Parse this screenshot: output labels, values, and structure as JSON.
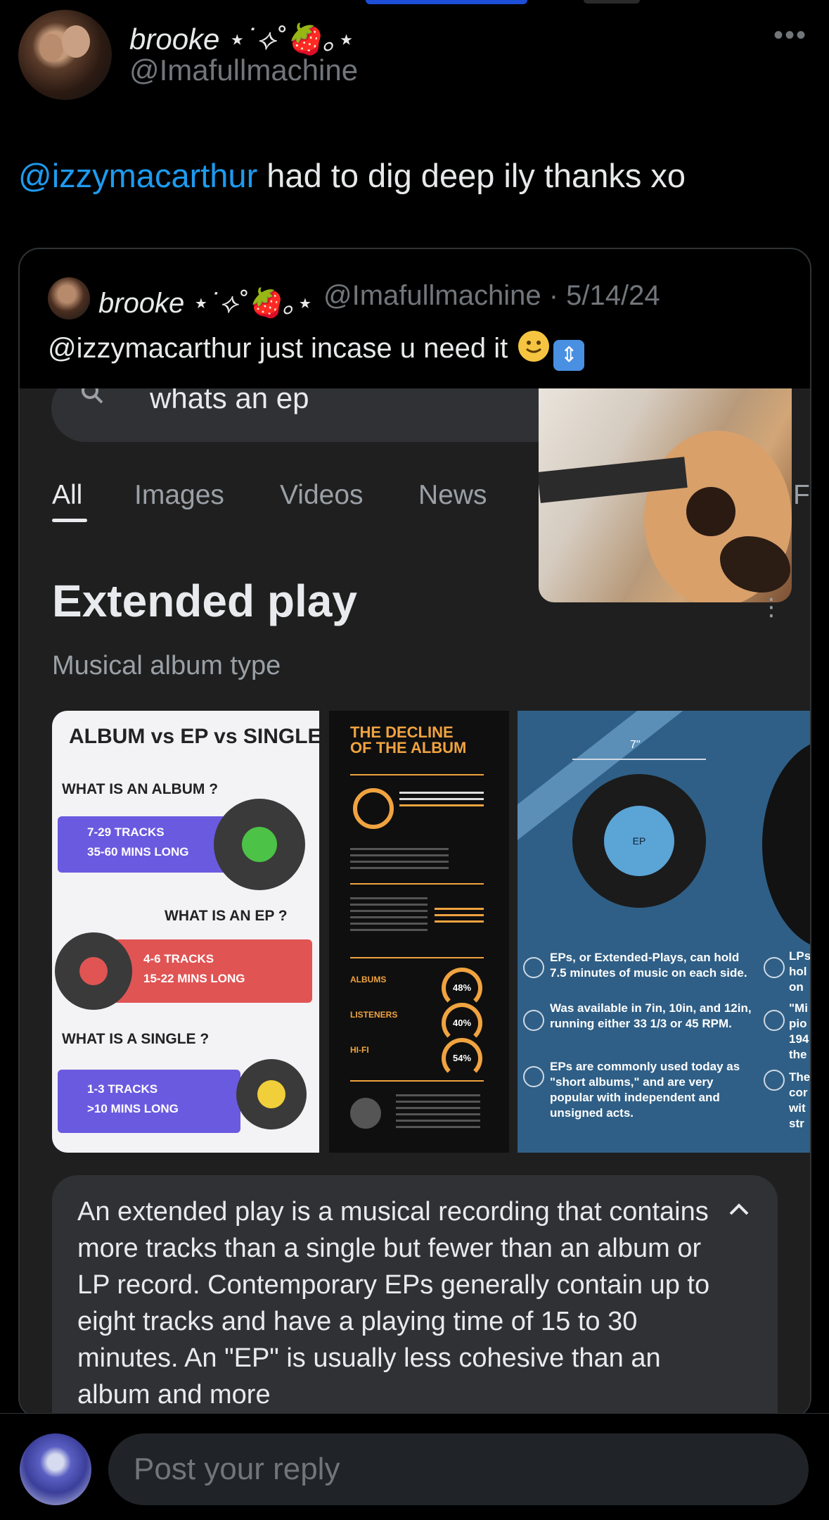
{
  "tweet": {
    "author_name": "brooke ⋆˙⟡˚🍓｡⋆",
    "author_handle": "@Imafullmachine",
    "more": "•••",
    "mention": "@izzymacarthur",
    "text": " had to dig deep ily thanks xo"
  },
  "quoted": {
    "author_name": "brooke ⋆˙⟡˚🍓｡⋆",
    "author_meta": "@Imafullmachine · 5/14/24",
    "text": "@izzymacarthur just incase u need it",
    "arrows": "⇕"
  },
  "screenshot": {
    "search_query": "whats an ep",
    "tabs": [
      "All",
      "Images",
      "Videos",
      "News",
      "F"
    ],
    "title": "Extended play",
    "subtitle": "Musical album type",
    "kebab": "⋮",
    "image1": {
      "heading": "ALBUM vs EP vs SINGLE",
      "q_album": "WHAT IS AN ALBUM ?",
      "album_tracks": "7-29 TRACKS",
      "album_mins": "35-60 MINS LONG",
      "q_ep": "WHAT IS AN EP ?",
      "ep_tracks": "4-6 TRACKS",
      "ep_mins": "15-22 MINS LONG",
      "q_single": "WHAT IS A SINGLE ?",
      "single_tracks": "1-3 TRACKS",
      "single_mins": ">10 MINS LONG"
    },
    "image2": {
      "title": "THE DECLINE\nOF THE ALBUM",
      "labels": [
        "ALBUMS",
        "LISTENERS",
        "HI-FI"
      ],
      "percents": [
        "48%",
        "40%",
        "54%"
      ]
    },
    "image3": {
      "dim": "7\"",
      "disc_label": "EP",
      "text1": "EPs, or Extended-Plays, can hold 7.5 minutes of music on each side.",
      "text2": "Was available in 7in, 10in, and 12in, running either 33 1/3 or 45 RPM.",
      "text3": "EPs are commonly used today as \"short albums,\" and are very popular with independent and unsigned acts.",
      "cut1": "LPs",
      "cut2": "hol",
      "cut3": "on",
      "cut4": "\"Mi",
      "cut5": "pio",
      "cut6": "194",
      "cut7": "the",
      "cut8": "The",
      "cut9": "cor",
      "cut10": "wit",
      "cut11": "str"
    },
    "description": "An extended play is a musical recording that contains more tracks than a single but fewer than an album or LP record. Contemporary EPs generally contain up to eight tracks and have a playing time of 15 to 30 minutes. An \"EP\" is usually less cohesive than an album and more"
  },
  "reply": {
    "placeholder": "Post your reply"
  }
}
